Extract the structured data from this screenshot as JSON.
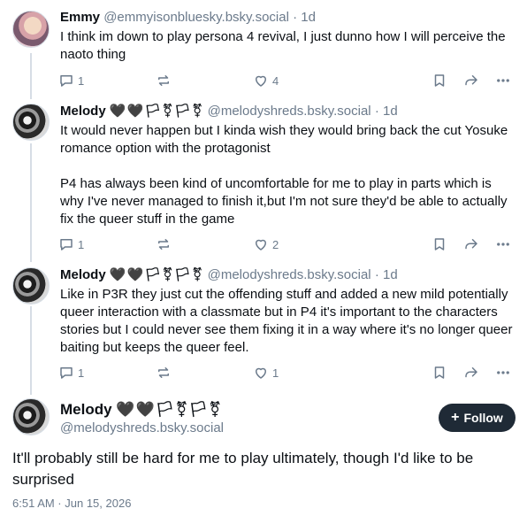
{
  "posts": [
    {
      "author": "Emmy",
      "name_extra": "",
      "handle": "@emmyisonbluesky.bsky.social",
      "age": "1d",
      "paragraphs": [
        "I think im down to play persona 4 revival, I just dunno how I will perceive the naoto thing"
      ],
      "replies": "1",
      "reposts": "",
      "likes": "4"
    },
    {
      "author": "Melody",
      "name_extra": "🖤🖤🏳⚧🏳⚧",
      "handle": "@melodyshreds.bsky.social",
      "age": "1d",
      "paragraphs": [
        "It would never happen but I kinda wish they would bring back the cut Yosuke romance option with the protagonist",
        "P4 has always been kind of uncomfortable for me to play in parts which is why I've never managed to finish it,but I'm not sure they'd be able  to actually fix the queer stuff in the game"
      ],
      "replies": "1",
      "reposts": "",
      "likes": "2"
    },
    {
      "author": "Melody",
      "name_extra": "🖤🖤🏳⚧🏳⚧",
      "handle": "@melodyshreds.bsky.social",
      "age": "1d",
      "paragraphs": [
        "Like in P3R they just cut the offending stuff and added a new mild potentially queer interaction with a classmate but in P4 it's important to the characters stories but I could never see them fixing it in a way where it's no longer queer baiting but keeps the queer feel."
      ],
      "replies": "1",
      "reposts": "",
      "likes": "1"
    }
  ],
  "focused": {
    "author": "Melody",
    "name_extra": "🖤🖤🏳⚧🏳⚧",
    "handle": "@melodyshreds.bsky.social",
    "follow_label": "Follow",
    "text": "It'll probably still be hard for me to play ultimately, though I'd like to be surprised",
    "timestamp": "6:51 AM · Jun 15, 2026"
  },
  "colors": {
    "muted": "#6b7a8b",
    "follow_bg": "#1f2a36",
    "thread_line": "#d6dde5"
  },
  "icons": [
    "reply-icon",
    "repost-icon",
    "like-icon",
    "bookmark-icon",
    "share-icon",
    "more-icon",
    "plus-icon"
  ]
}
